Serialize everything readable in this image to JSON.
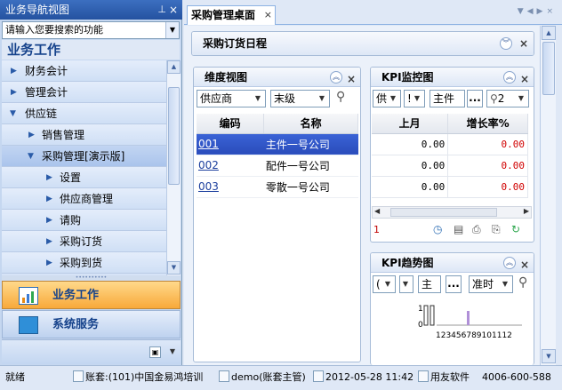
{
  "nav": {
    "title": "业务导航视图",
    "search_placeholder": "请输入您要搜索的功能",
    "section_title": "业务工作",
    "tree": [
      {
        "label": "财务会计",
        "level": 0,
        "expanded": false
      },
      {
        "label": "管理会计",
        "level": 0,
        "expanded": false
      },
      {
        "label": "供应链",
        "level": 0,
        "expanded": true
      },
      {
        "label": "销售管理",
        "level": 1,
        "expanded": false
      },
      {
        "label": "采购管理[演示版]",
        "level": 1,
        "expanded": true
      },
      {
        "label": "设置",
        "level": 2,
        "expanded": false
      },
      {
        "label": "供应商管理",
        "level": 2,
        "expanded": false
      },
      {
        "label": "请购",
        "level": 2,
        "expanded": false
      },
      {
        "label": "采购订货",
        "level": 2,
        "expanded": false
      },
      {
        "label": "采购到货",
        "level": 2,
        "expanded": false
      }
    ],
    "btn_business": "业务工作",
    "btn_system": "系统服务"
  },
  "tabs": {
    "active": "采购管理桌面"
  },
  "schedule": {
    "title": "采购订货日程"
  },
  "dimension": {
    "title": "维度视图",
    "select1": "供应商",
    "select2": "末级",
    "columns": [
      "编码",
      "名称"
    ],
    "rows": [
      {
        "code": "001",
        "name": "主件一号公司",
        "selected": true
      },
      {
        "code": "002",
        "name": "配件一号公司",
        "selected": false
      },
      {
        "code": "003",
        "name": "零散一号公司",
        "selected": false
      }
    ]
  },
  "kpi": {
    "title": "KPI监控图",
    "sel1": "供",
    "sel2": "!",
    "sel3": "主件",
    "more": "...",
    "sel4": "2",
    "columns": [
      "上月",
      "增长率%"
    ],
    "rows": [
      {
        "last_month": "0.00",
        "growth": "0.00"
      },
      {
        "last_month": "0.00",
        "growth": "0.00"
      },
      {
        "last_month": "0.00",
        "growth": "0.00"
      }
    ],
    "page": "1"
  },
  "trend": {
    "title": "KPI趋势图",
    "sel1": "(",
    "sel3": "主",
    "more": "...",
    "sel4": "准时",
    "y_top": "1",
    "y_bottom": "0",
    "x_ticks": "123456789101112"
  },
  "status": {
    "ready": "就绪",
    "account": "账套:(101)中国金易鸿培训",
    "user": "demo(账套主管)",
    "date": "2012-05-28 11:42",
    "vendor": "用友软件",
    "phone": "4006-600-588"
  }
}
